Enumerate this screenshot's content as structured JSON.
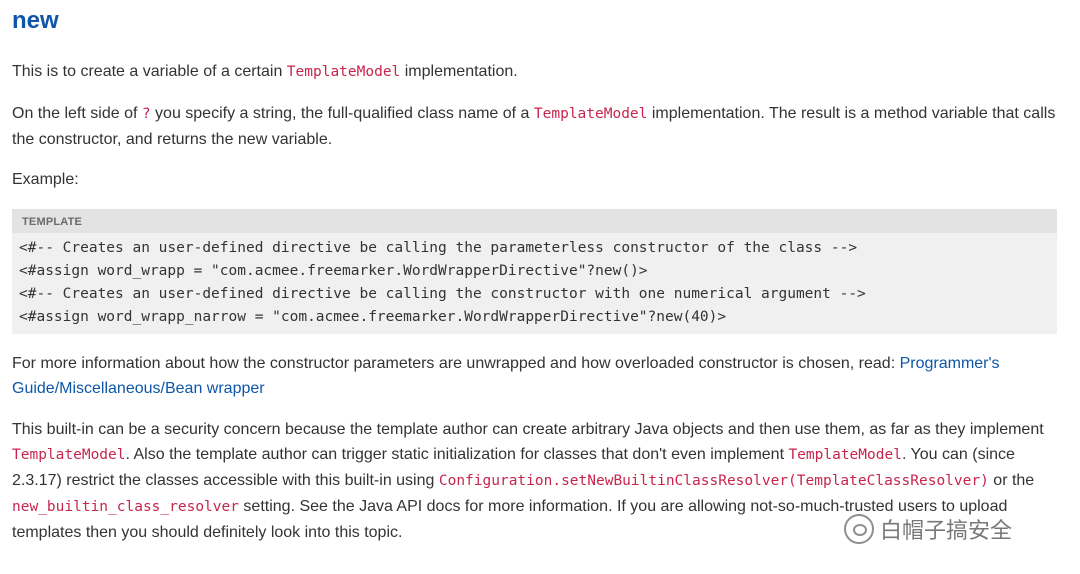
{
  "section": {
    "title": "new"
  },
  "para1": {
    "before": "This is to create a variable of a certain ",
    "code": "TemplateModel",
    "after": " implementation."
  },
  "para2": {
    "t1": "On the left side of ",
    "code1": "?",
    "t2": " you specify a string, the full-qualified class name of a ",
    "code2": "TemplateModel",
    "t3": " implementation. The result is a method variable that calls the constructor, and returns the new variable."
  },
  "para3": {
    "text": "Example:"
  },
  "code_block": {
    "label": "TEMPLATE",
    "lines": [
      "<#-- Creates an user-defined directive be calling the parameterless constructor of the class -->",
      "<#assign word_wrapp = \"com.acmee.freemarker.WordWrapperDirective\"?new()>",
      "<#-- Creates an user-defined directive be calling the constructor with one numerical argument -->",
      "<#assign word_wrapp_narrow = \"com.acmee.freemarker.WordWrapperDirective\"?new(40)>"
    ]
  },
  "para4": {
    "text": "For more information about how the constructor parameters are unwrapped and how overloaded constructor is chosen, read: ",
    "link": "Programmer's Guide/Miscellaneous/Bean wrapper"
  },
  "para5": {
    "t1": "This built-in can be a security concern because the template author can create arbitrary Java objects and then use them, as far as they implement ",
    "code1": "TemplateModel",
    "t2": ". Also the template author can trigger static initialization for classes that don't even implement ",
    "code2": "TemplateModel",
    "t3": ". You can (since 2.3.17) restrict the classes accessible with this built-in using ",
    "code3": "Configuration.setNewBuiltinClassResolver(TemplateClassResolver)",
    "t4": " or the ",
    "code4": "new_builtin_class_resolver",
    "t5": " setting. See the Java API docs for more information. If you are allowing not-so-much-trusted users to upload templates then you should definitely look into this topic."
  },
  "watermark": {
    "text": "白帽子搞安全"
  },
  "colors": {
    "heading": "#0e56a8",
    "code": "#c7254e",
    "link": "#0e56a8",
    "code_bg": "#f0f0f0"
  }
}
